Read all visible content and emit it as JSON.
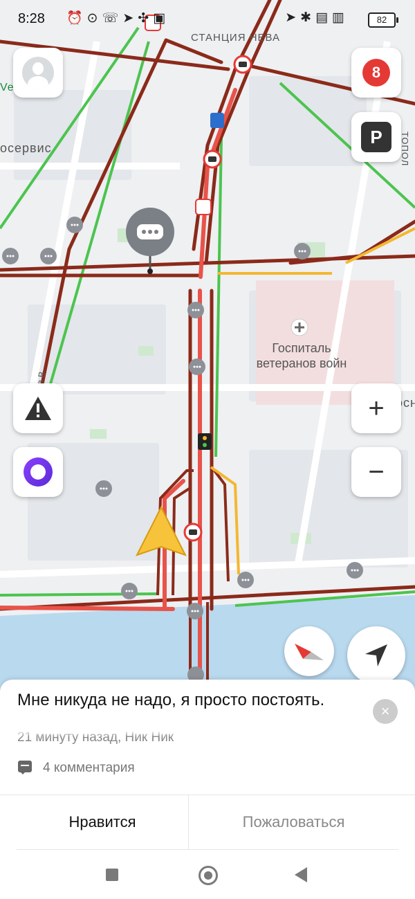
{
  "status_bar": {
    "time": "8:28",
    "left_icons": [
      "alarm-icon",
      "clock-icon",
      "whatsapp-icon",
      "send-icon",
      "fan-icon",
      "car-icon"
    ],
    "right_icons": [
      "location-icon",
      "bluetooth-icon",
      "volte-icon",
      "4g-signal-icon"
    ],
    "battery": "82"
  },
  "map": {
    "labels": {
      "station": "СТАНЦИЯ НЕВА",
      "left_service": "осервис",
      "left_brand": "VelVeX",
      "hospital_line1": "Госпиталь",
      "hospital_line2": "ветеранов войн",
      "right_edge": "ТОПОЛ",
      "right_edge2": "осн",
      "street_vertical": "ул. Чекистов В"
    },
    "traffic_score": "8",
    "parking_label": "P",
    "colors": {
      "jam_dark": "#8b2a1a",
      "jam": "#e8534a",
      "slow": "#f5b731",
      "free": "#4cc44f",
      "water": "#b9d9ef"
    }
  },
  "controls": {
    "zoom_in": "+",
    "zoom_out": "−"
  },
  "sheet": {
    "comment_text": "Мне никуда не надо, я просто постоять.",
    "meta": "21 минуту назад, Ник Ник",
    "comments_count": "4 комментария",
    "close": "×",
    "like_label": "Нравится",
    "report_label": "Пожаловаться"
  }
}
